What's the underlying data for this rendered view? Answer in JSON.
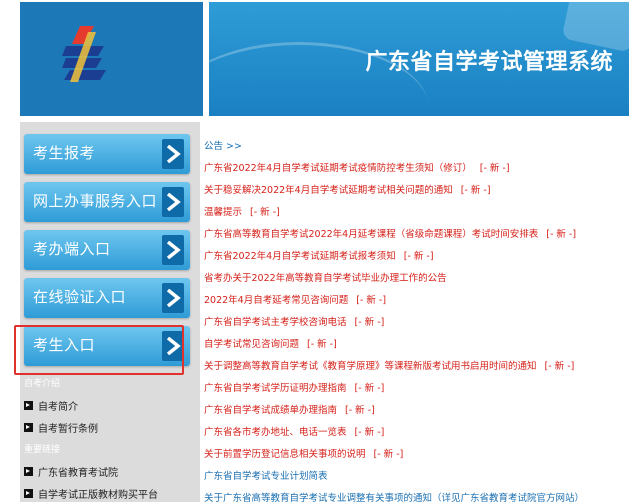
{
  "header": {
    "title": "广东省自学考试管理系统"
  },
  "sidebar": {
    "buttons": [
      {
        "label": "考生报考"
      },
      {
        "label": "网上办事服务入口"
      },
      {
        "label": "考办端入口"
      },
      {
        "label": "在线验证入口"
      },
      {
        "label": "考生入口"
      }
    ],
    "section1_title": "自考介绍",
    "section1_links": [
      "自考简介",
      "自考暂行条例"
    ],
    "section2_title": "重要链接",
    "section2_links": [
      "广东省教育考试院",
      "自学考试正版教材购买平台"
    ]
  },
  "notices": {
    "heading": "公告 >>",
    "new_label": "[- 新 -]",
    "items": [
      {
        "title": "广东省2022年4月自学考试延期考试疫情防控考生须知（修订）"
      },
      {
        "title": "关于稳妥解决2022年4月自学考试延期考试相关问题的通知"
      },
      {
        "title": "温馨提示"
      },
      {
        "title": "广东省高等教育自学考试2022年4月延考课程（省级命题课程）考试时间安排表"
      },
      {
        "title": "广东省2022年4月自学考试延期考试报考须知"
      },
      {
        "title": "省考办关于2022年高等教育自学考试毕业办理工作的公告"
      },
      {
        "title": "2022年4月自考延考常见咨询问题"
      },
      {
        "title": "广东省自学考试主考学校咨询电话"
      },
      {
        "title": "自学考试常见咨询问题"
      },
      {
        "title": "关于调整高等教育自学考试《教育学原理》等课程新版考试用书启用时间的通知"
      },
      {
        "title": "广东省自学考试学历证明办理指南"
      },
      {
        "title": "广东省自学考试成绩单办理指南"
      },
      {
        "title": "广东省各市考办地址、电话一览表"
      },
      {
        "title": "关于前置学历登记信息相关事项的说明"
      },
      {
        "title": "广东省自学考试专业计划简表"
      },
      {
        "title": "关于广东省高等教育自学考试专业调整有关事项的通知（详见广东省教育考试院官方网站）"
      }
    ]
  }
}
